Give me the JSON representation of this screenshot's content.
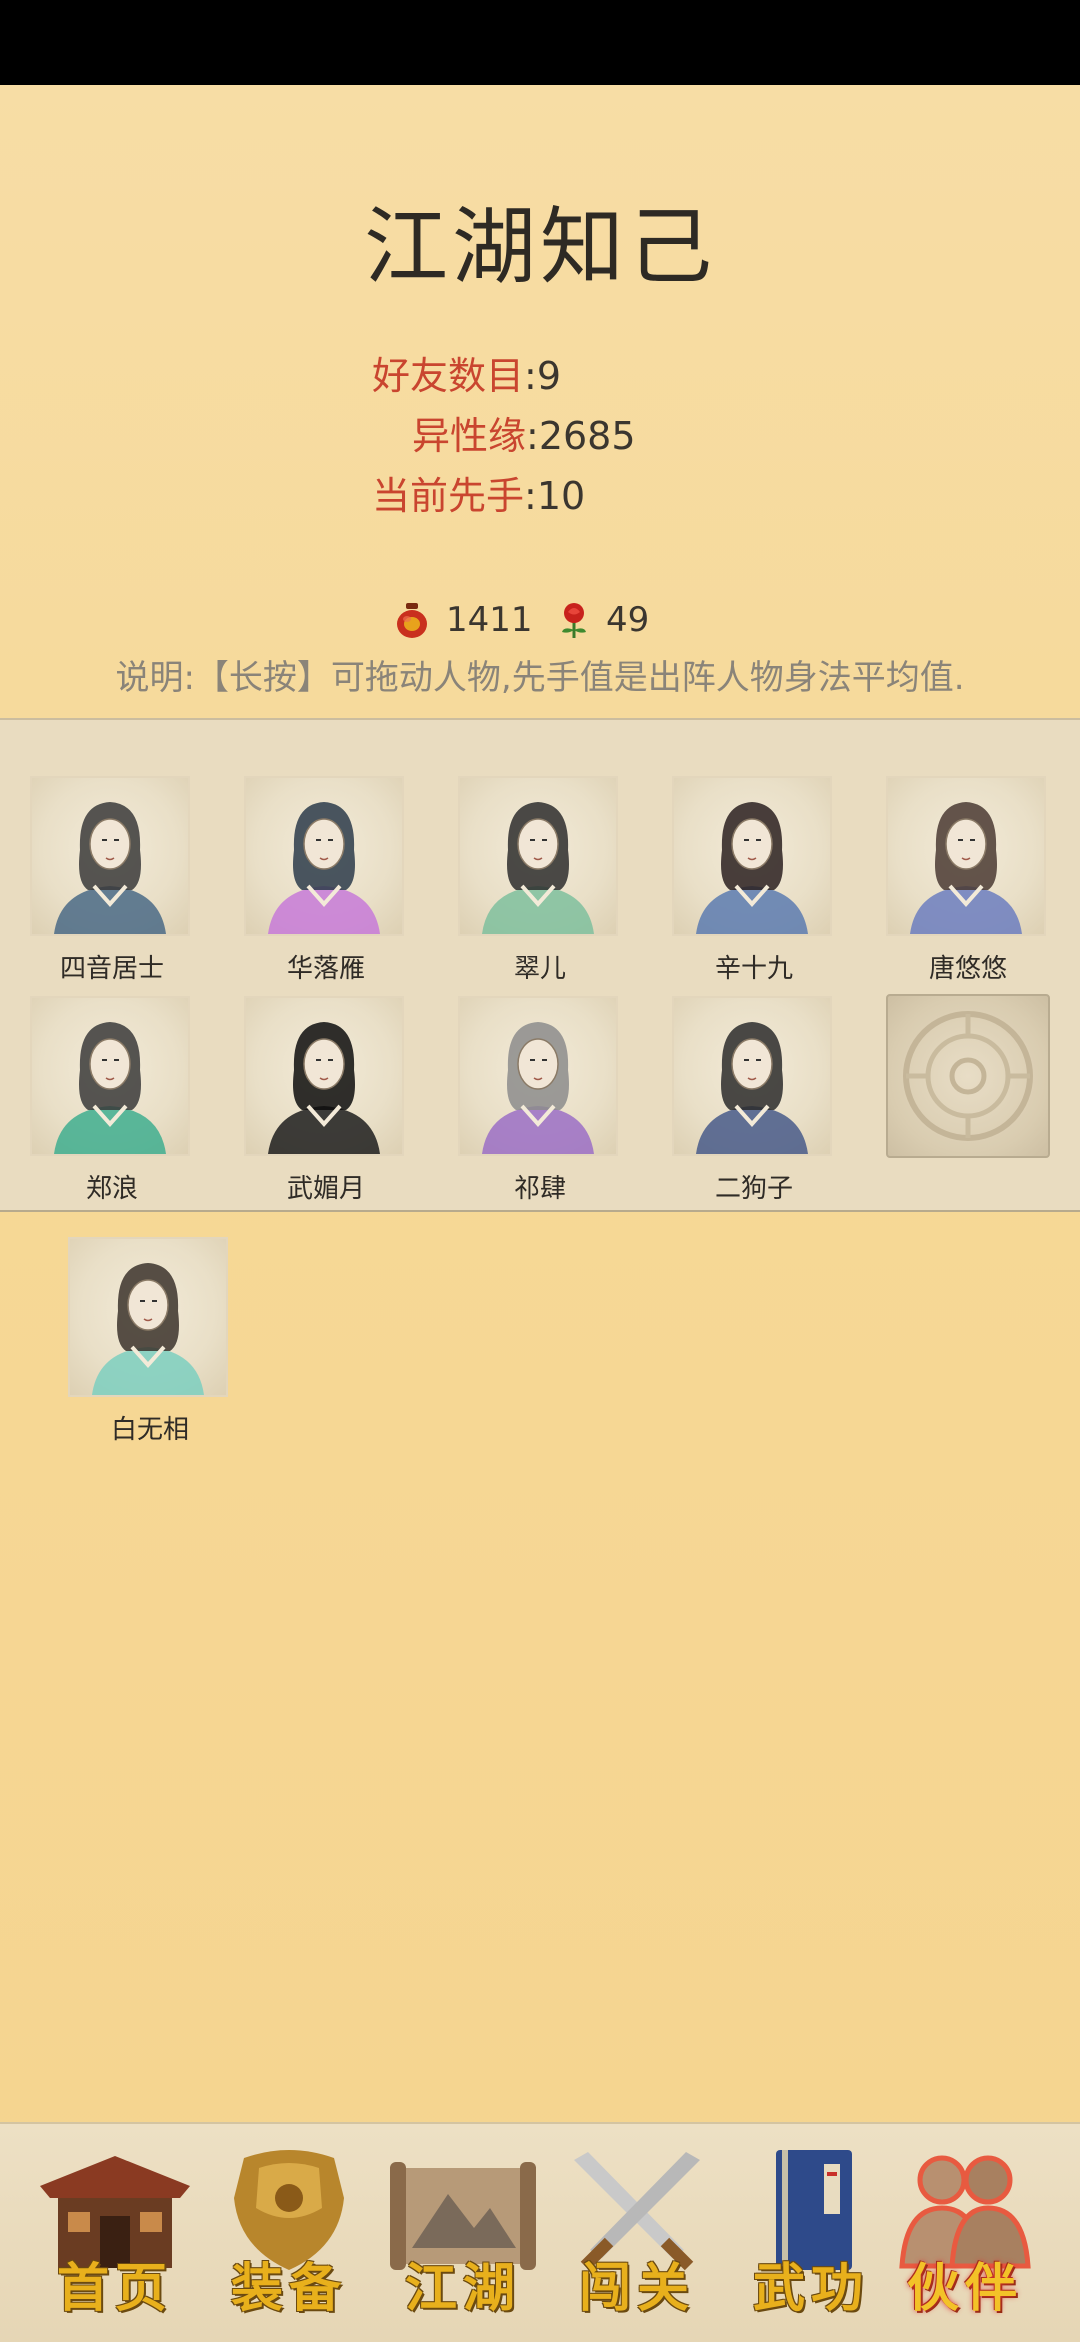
{
  "page": {
    "title": "江湖知己"
  },
  "stats": [
    {
      "label": "好友数目",
      "value": "9"
    },
    {
      "label": "异性缘",
      "value": "2685"
    },
    {
      "label": "当前先手",
      "value": "10"
    }
  ],
  "currency": [
    {
      "icon": "wine-jar-icon",
      "value": "1411"
    },
    {
      "icon": "rose-icon",
      "value": "49"
    }
  ],
  "note": "说明:【长按】可拖动人物,先手值是出阵人物身法平均值.",
  "team": [
    {
      "name": "四音居士",
      "robe": "#4a6a86",
      "hair": "#3a3a3a"
    },
    {
      "name": "华落雁",
      "robe": "#c77ad8",
      "hair": "#2b3b4a"
    },
    {
      "name": "翠儿",
      "robe": "#7fbf9e",
      "hair": "#2d2d2d"
    },
    {
      "name": "辛十九",
      "robe": "#5c7bb0",
      "hair": "#2a2020"
    },
    {
      "name": "唐悠悠",
      "robe": "#6c7ec0",
      "hair": "#4a3a33"
    },
    {
      "name": "郑浪",
      "robe": "#3fae8f",
      "hair": "#3a3a3a"
    },
    {
      "name": "武媚月",
      "robe": "#1d1d1d",
      "hair": "#0d0d0d"
    },
    {
      "name": "祁肆",
      "robe": "#9b6fc6",
      "hair": "#8c8c8c"
    },
    {
      "name": "二狗子",
      "robe": "#485a8a",
      "hair": "#2b2b2b"
    }
  ],
  "bench": [
    {
      "name": "白无相",
      "robe": "#7ccfc0",
      "hair": "#3b332b"
    }
  ],
  "nav": [
    {
      "label": "首页",
      "icon": "house-icon"
    },
    {
      "label": "装备",
      "icon": "armor-icon"
    },
    {
      "label": "江湖",
      "icon": "scroll-map-icon"
    },
    {
      "label": "闯关",
      "icon": "crossed-swords-icon"
    },
    {
      "label": "武功",
      "icon": "book-icon"
    },
    {
      "label": "伙伴",
      "icon": "companions-icon",
      "active": true
    }
  ]
}
